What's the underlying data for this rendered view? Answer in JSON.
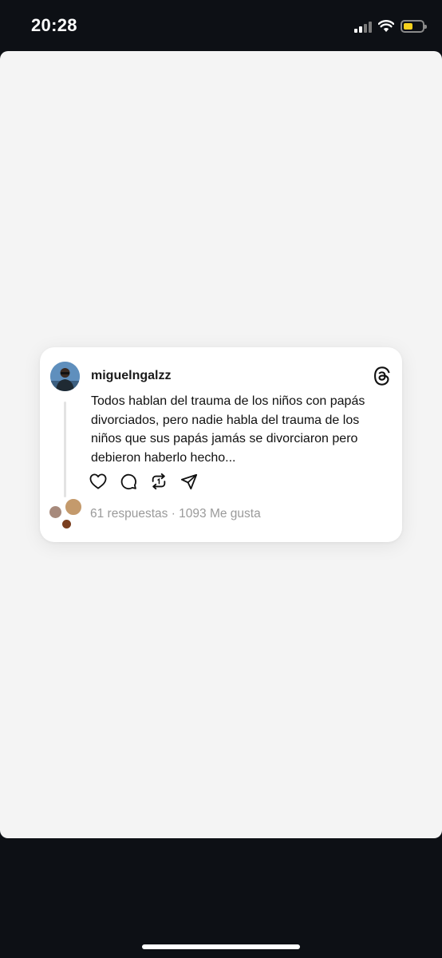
{
  "status_bar": {
    "time": "20:28",
    "icons": [
      "signal-icon",
      "wifi-icon",
      "battery-icon"
    ],
    "battery_color": "#f7d21e"
  },
  "post": {
    "username": "miguelngalzz",
    "text": "Todos hablan del trauma de los niños con papás divorciados, pero nadie habla del trauma de los niños que sus papás jamás se divorciaron pero debieron haberlo hecho...",
    "actions": [
      "heart-icon",
      "comment-icon",
      "repost-icon",
      "share-icon"
    ],
    "replies": "61 respuestas",
    "separator": "·",
    "likes": "1093 Me gusta",
    "brand_icon": "threads-logo-icon"
  },
  "colors": {
    "background_dark": "#0d1015",
    "sheet": "#f4f4f4",
    "card": "#ffffff",
    "muted_text": "#9a9a9a"
  }
}
